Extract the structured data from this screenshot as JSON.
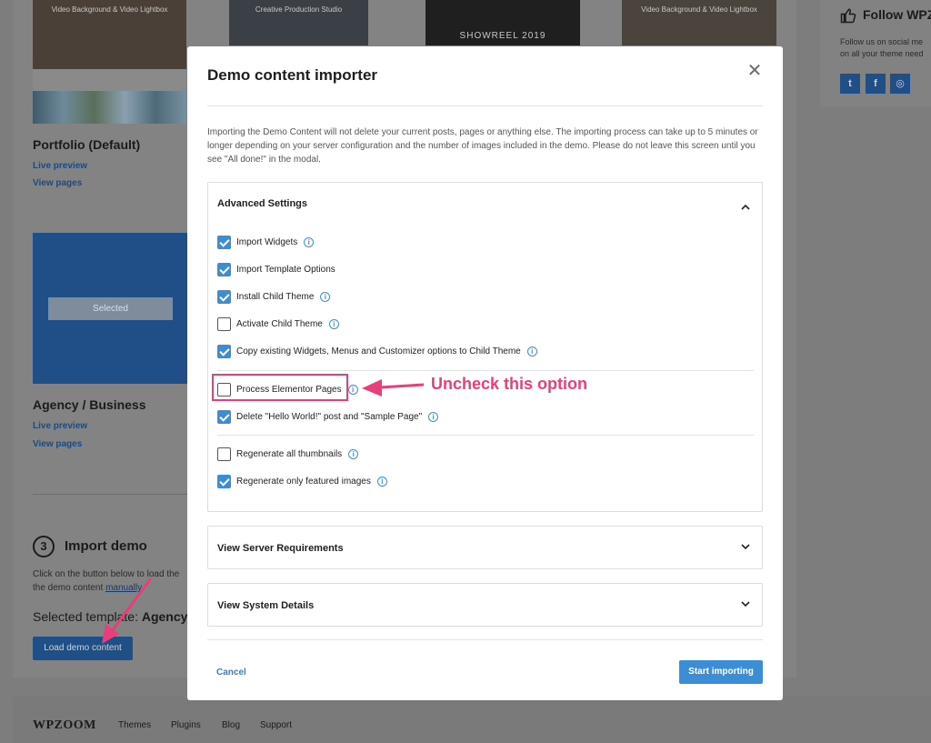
{
  "background": {
    "thumbnails": [
      {
        "caption": "Video Background & Video Lightbox"
      },
      {
        "caption": "Creative Production Studio"
      },
      {
        "caption": "SHOWREEL 2019"
      },
      {
        "caption": "Video Background & Video Lightbox"
      }
    ],
    "portfolio": {
      "title": "Portfolio (Default)",
      "live_preview": "Live preview",
      "view_pages": "View pages"
    },
    "agency": {
      "selected_label": "Selected",
      "title": "Agency / Business",
      "live_preview": "Live preview",
      "view_pages": "View pages"
    },
    "import_step": {
      "number": "3",
      "title": "Import demo",
      "text_line1": "Click on the button below to load the",
      "text_line2_prefix": "the demo content ",
      "text_line2_link": "manually",
      "selected_template_prefix": "Selected template: ",
      "selected_template_value": "Agency /",
      "load_button": "Load demo content"
    },
    "follow": {
      "title": "Follow WPZ",
      "text_line1": "Follow us on social me",
      "text_line2": "on all your theme need",
      "social": [
        "t",
        "f",
        "◎"
      ]
    },
    "footer": {
      "logo": "WPZOOM",
      "nav": [
        "Themes",
        "Plugins",
        "Blog",
        "Support"
      ]
    }
  },
  "modal": {
    "title": "Demo content importer",
    "intro": "Importing the Demo Content will not delete your current posts, pages or anything else. The importing process can take up to 5 minutes or longer depending on your server configuration and the number of images included in the demo. Please do not leave this screen until you see \"All done!\" in the modal.",
    "advanced": {
      "title": "Advanced Settings",
      "options": [
        {
          "label": "Import Widgets",
          "checked": true,
          "info": true
        },
        {
          "label": "Import Template Options",
          "checked": true,
          "info": false
        },
        {
          "label": "Install Child Theme",
          "checked": true,
          "info": true
        },
        {
          "label": "Activate Child Theme",
          "checked": false,
          "info": true
        },
        {
          "label": "Copy existing Widgets, Menus and Customizer options to Child Theme",
          "checked": true,
          "info": true
        },
        {
          "label": "Process Elementor Pages",
          "checked": false,
          "info": true
        },
        {
          "label": "Delete \"Hello World!\" post and \"Sample Page\"",
          "checked": true,
          "info": true
        },
        {
          "label": "Regenerate all thumbnails",
          "checked": false,
          "info": true
        },
        {
          "label": "Regenerate only featured images",
          "checked": true,
          "info": true
        }
      ]
    },
    "server_requirements": {
      "title": "View Server Requirements"
    },
    "system_details": {
      "title": "View System Details"
    },
    "cancel_label": "Cancel",
    "start_label": "Start importing"
  },
  "annotation": {
    "text": "Uncheck this option",
    "color": "#ea3d7a"
  },
  "colors": {
    "accent": "#3b8ed6",
    "annotation": "#ea3d7a"
  }
}
